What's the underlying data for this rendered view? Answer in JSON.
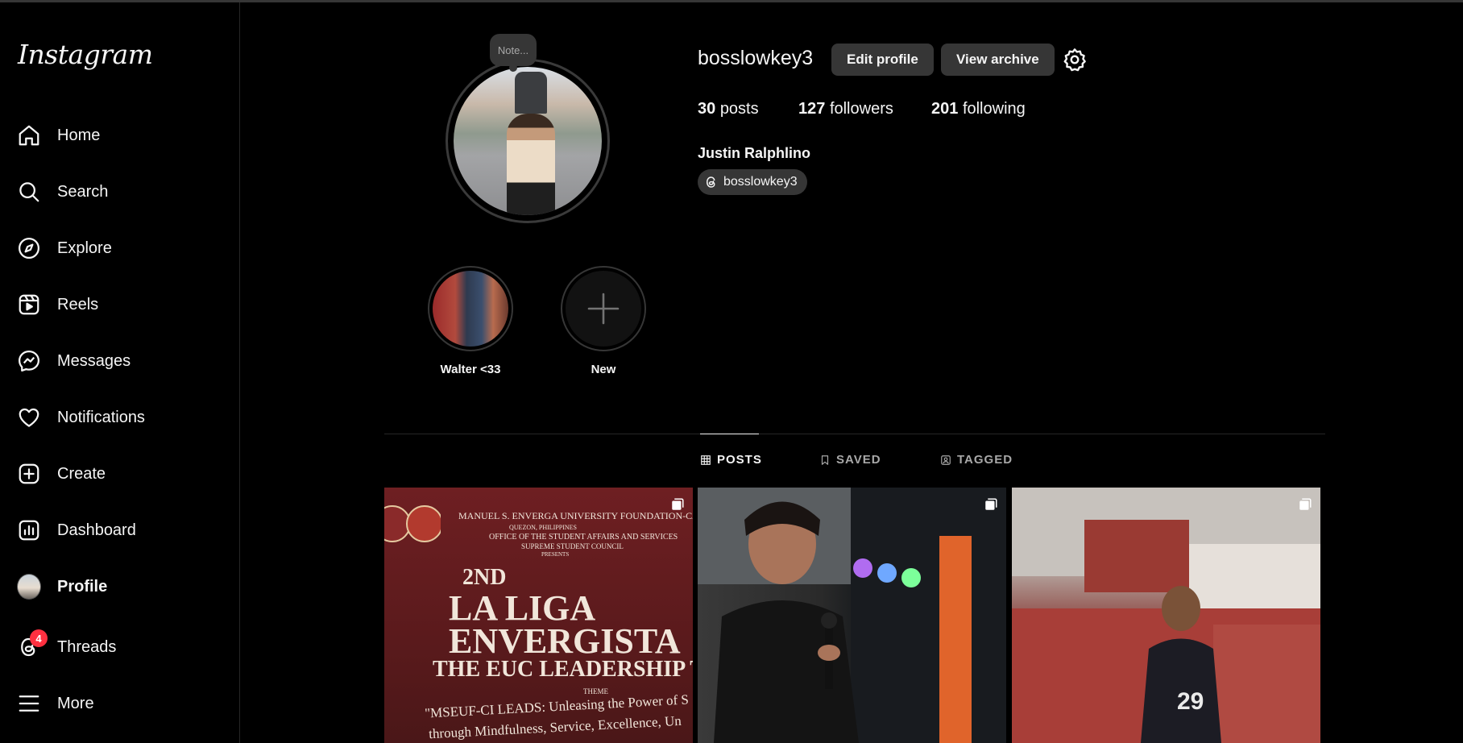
{
  "app": {
    "logo": "Instagram"
  },
  "nav": [
    {
      "label": "Home",
      "icon": "home-icon"
    },
    {
      "label": "Search",
      "icon": "search-icon"
    },
    {
      "label": "Explore",
      "icon": "explore-icon"
    },
    {
      "label": "Reels",
      "icon": "reels-icon"
    },
    {
      "label": "Messages",
      "icon": "messenger-icon"
    },
    {
      "label": "Notifications",
      "icon": "heart-icon"
    },
    {
      "label": "Create",
      "icon": "plus-square-icon"
    },
    {
      "label": "Dashboard",
      "icon": "dashboard-icon"
    },
    {
      "label": "Profile",
      "icon": "avatar"
    },
    {
      "label": "Threads",
      "icon": "threads-icon",
      "badge": "4"
    },
    {
      "label": "More",
      "icon": "hamburger-icon"
    }
  ],
  "profile": {
    "note": "Note...",
    "username": "bosslowkey3",
    "edit_label": "Edit profile",
    "archive_label": "View archive",
    "posts_count": "30",
    "posts_label": "posts",
    "followers_count": "127",
    "followers_label": "followers",
    "following_count": "201",
    "following_label": "following",
    "full_name": "Justin Ralphlino",
    "threads_handle": "bosslowkey3"
  },
  "highlights": [
    {
      "label": "Walter <33"
    },
    {
      "label": "New"
    }
  ],
  "tabs": [
    {
      "label": "POSTS",
      "icon": "grid-icon",
      "active": true
    },
    {
      "label": "SAVED",
      "icon": "bookmark-icon",
      "active": false
    },
    {
      "label": "TAGGED",
      "icon": "tagged-icon",
      "active": false
    }
  ],
  "posts": {
    "p1": {
      "line1": "MANUEL S. ENVERGA UNIVERSITY FOUNDATION-CANDE",
      "line2": "QUEZON, PHILIPPINES",
      "line3": "OFFICE OF THE STUDENT AFFAIRS AND SERVICES",
      "line4": "SUPREME STUDENT COUNCIL",
      "line5": "PRESENTS",
      "line6": "2ND",
      "line7": "LA LIGA",
      "line8": "ENVERGISTA",
      "line9": "THE EUC LEADERSHIP T",
      "line10": "THEME",
      "line11": "\"MSEUF-CI LEADS: Unleasing the Power of S",
      "line12": "through Mindfulness, Service, Excellence, Un"
    }
  },
  "colors": {
    "background": "#000000",
    "button": "#363636",
    "badge": "#ff3040",
    "border": "#262626"
  }
}
